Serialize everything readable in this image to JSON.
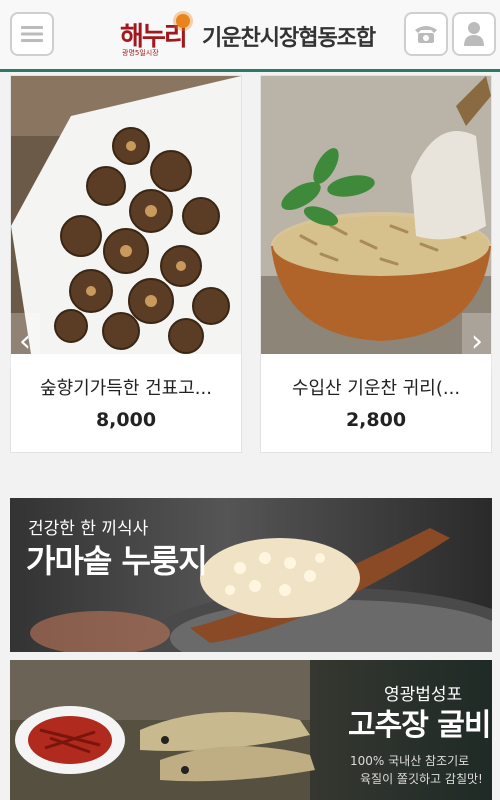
{
  "header": {
    "brand": "해누리",
    "brand_tag": "광명5일시장",
    "title": "기운찬시장협동조합",
    "menu_icon": "hamburger-menu-icon",
    "phone_icon": "phone-icon",
    "user_icon": "user-icon",
    "accent_color": "#2b7a66"
  },
  "products": [
    {
      "name": "숲향기가득한 건표고...",
      "price": "8,000",
      "image": "dried shiitake mushrooms"
    },
    {
      "name": "수입산 기운찬 귀리(...",
      "price": "2,800",
      "image": "oats in wooden bowl"
    }
  ],
  "carousel": {
    "prev_label": "‹",
    "next_label": "›"
  },
  "banners": [
    {
      "subtitle": "건강한 한 끼식사",
      "title": "가마솥 누룽지"
    },
    {
      "subtitle": "영광법성포",
      "title": "고추장 굴비",
      "desc_line1": "100% 국내산 참조기로",
      "desc_line2": "육질이 쫄깃하고 감칠맛!"
    }
  ]
}
